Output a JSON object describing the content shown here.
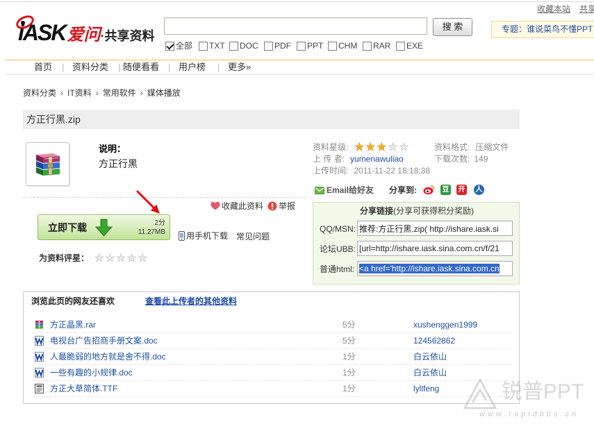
{
  "top_links": {
    "favorite": "收藏本站",
    "share": "共享"
  },
  "logo": {
    "iask": "iASK",
    "aiwen": "爱问",
    "suffix": "·共享资料"
  },
  "search": {
    "value": "",
    "button_label": "搜 索"
  },
  "topic": {
    "label": "专题：谁说菜鸟不懂PPT"
  },
  "filters": [
    {
      "label": "全部",
      "checked": true
    },
    {
      "label": "TXT",
      "checked": false
    },
    {
      "label": "DOC",
      "checked": false
    },
    {
      "label": "PDF",
      "checked": false
    },
    {
      "label": "PPT",
      "checked": false
    },
    {
      "label": "CHM",
      "checked": false
    },
    {
      "label": "RAR",
      "checked": false
    },
    {
      "label": "EXE",
      "checked": false
    }
  ],
  "nav": {
    "items": [
      "首页",
      "资料分类",
      "随便看看",
      "用户榜",
      "更多»"
    ],
    "separator": "|"
  },
  "breadcrumb": {
    "items": [
      "资料分类",
      "IT资料",
      "常用软件",
      "媒体播放"
    ],
    "separator": "›"
  },
  "file": {
    "title": "方正行黑.zip",
    "icon": "winrar-archive-icon",
    "desc_label": "说明：",
    "desc": "方正行黑",
    "star_label": "资料星级:",
    "star_rating": 3,
    "star_max": 5,
    "format_label": "资料格式:",
    "format": "压缩文件",
    "uploader_label": "上 传 者:",
    "uploader": "yumenawuliao",
    "downloads_label": "下载次数:",
    "downloads": "149",
    "upload_time_label": "上传时间:",
    "upload_time": "2011-11-22 18:18:38"
  },
  "actions": {
    "email": "Email给好友",
    "share_to": "分享到:",
    "share_icons": [
      {
        "name": "weibo-icon"
      },
      {
        "name": "douban-icon",
        "glyph": "豆"
      },
      {
        "name": "kaixin-icon",
        "glyph": "开"
      },
      {
        "name": "renren-icon",
        "glyph": "人"
      }
    ],
    "favorite": "收藏此资料",
    "report": "举报",
    "download": "立即下载",
    "cost": "2分",
    "size": "11.27MB",
    "mobile": "用手机下载",
    "faq": "常见问题",
    "rate_label": "为资料评星：",
    "user_rating": 0,
    "rating_max": 5
  },
  "share_box": {
    "title": "分享链接",
    "subtitle": "(分享可获得积分奖励)",
    "rows": [
      {
        "label": "QQ/MSN:",
        "value": "推荐:方正行黑.zip( http://ishare.iask.si"
      },
      {
        "label": "论坛UBB:",
        "value": "[url=http://ishare.iask.sina.com.cn/f/21"
      },
      {
        "label": "普通html:",
        "value": "<a href='http://ishare.iask.sina.com.cn",
        "selected": true
      }
    ]
  },
  "related": {
    "heading": "浏览此页的网友还喜欢",
    "uploader_link": "查看此上传者的其他资料",
    "items": [
      {
        "icon": "rar-file-icon",
        "name": "方正晶黑.rar",
        "score": "5分",
        "user": "xushenggen1999"
      },
      {
        "icon": "word-file-icon",
        "name": "电视台广告招商手册文案.doc",
        "score": "5分",
        "user": "124562862"
      },
      {
        "icon": "word-file-icon",
        "name": "人最脆弱的地方就是舍不得.doc",
        "score": "1分",
        "user": "白云依山"
      },
      {
        "icon": "word-file-icon",
        "name": "一些有趣的小规律.doc",
        "score": "1分",
        "user": "白云依山"
      },
      {
        "icon": "font-file-icon",
        "name": "方正大草简体.TTF",
        "score": "1分",
        "user": "lyllfeng"
      }
    ]
  },
  "watermark": {
    "brand": "锐普PPT",
    "url": "www.rapidbbs.cn"
  },
  "colors": {
    "link": "#1b4ba7",
    "logo_red": "#d6161b",
    "title_bar_bg": "#eeeeee",
    "share_box_bg": "#f2f9e9",
    "download_green": "#3aa52f",
    "star_filled": "#f5b020",
    "annotation_arrow": "#e01010"
  }
}
